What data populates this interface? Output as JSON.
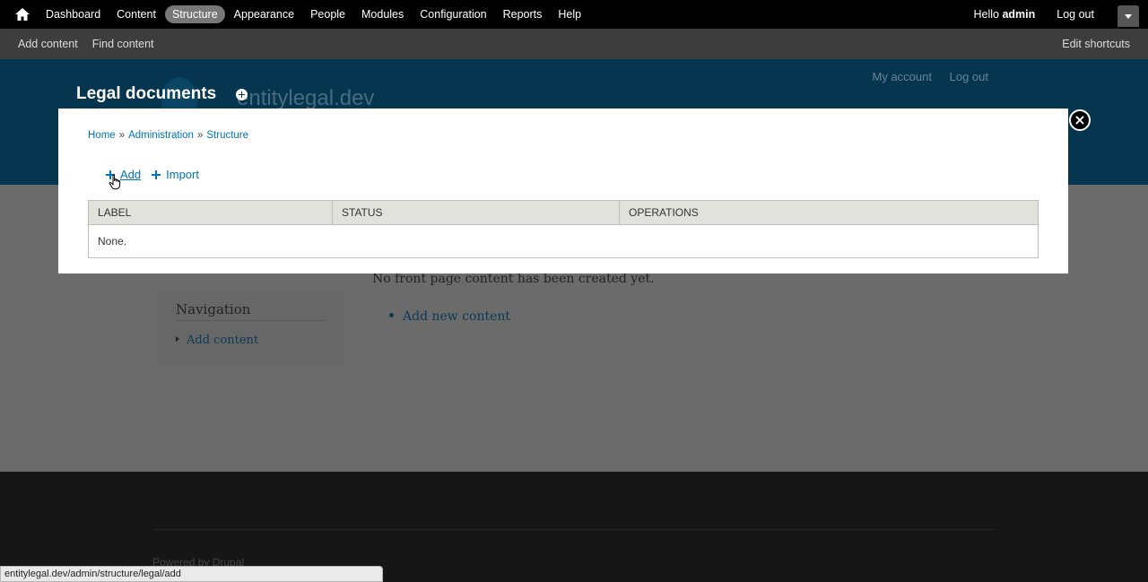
{
  "toolbar": {
    "home_icon": "home-icon",
    "menu": [
      "Dashboard",
      "Content",
      "Structure",
      "Appearance",
      "People",
      "Modules",
      "Configuration",
      "Reports",
      "Help"
    ],
    "active_item": "Structure",
    "hello_prefix": "Hello ",
    "user": "admin",
    "logout": "Log out"
  },
  "shortcuts": {
    "links": [
      "Add content",
      "Find content"
    ],
    "edit": "Edit shortcuts"
  },
  "header": {
    "site_name": "entitylegal.dev",
    "secondary_menu": [
      "My account",
      "Log out"
    ]
  },
  "main": {
    "sidebar_title": "Navigation",
    "sidebar_link": "Add content",
    "front_message": "No front page content has been created yet.",
    "add_new": "Add new content"
  },
  "footer": {
    "powered_by": "Powered by Drupal"
  },
  "overlay": {
    "title": "Legal documents",
    "breadcrumb": [
      "Home",
      "Administration",
      "Structure"
    ],
    "breadcrumb_sep": "»",
    "close_symbol": "×",
    "actions": [
      "Add",
      "Import"
    ],
    "table": {
      "headers": [
        "Label",
        "Status",
        "Operations"
      ],
      "empty": "None."
    }
  },
  "statusbar": {
    "url": "entitylegal.dev/admin/structure/legal/add"
  },
  "colors": {
    "link": "#0074bd",
    "toolbar_bg": "#000000",
    "header_bg": "#05354f"
  }
}
